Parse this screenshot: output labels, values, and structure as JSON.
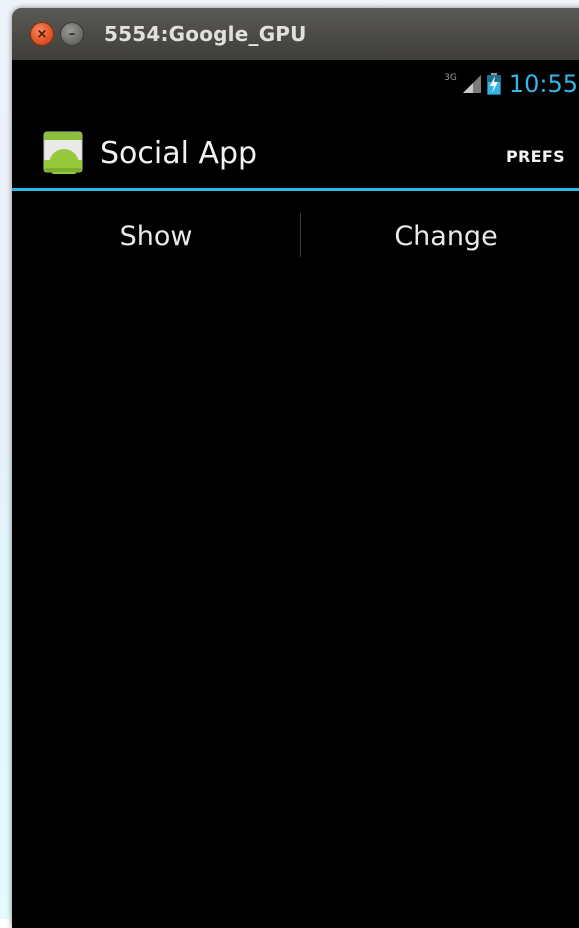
{
  "window": {
    "title": "5554:Google_GPU",
    "close_glyph": "×",
    "minimize_glyph": "–"
  },
  "status_bar": {
    "network_type": "3G",
    "time": "10:55",
    "time_color": "#33b5e5",
    "icons": [
      "signal-icon",
      "battery-charging-icon"
    ]
  },
  "action_bar": {
    "app_title": "Social App",
    "app_icon": "android-app-icon",
    "action_label": "PREFS",
    "accent_color": "#33b5e5"
  },
  "tabs": [
    {
      "label": "Show"
    },
    {
      "label": "Change"
    }
  ]
}
